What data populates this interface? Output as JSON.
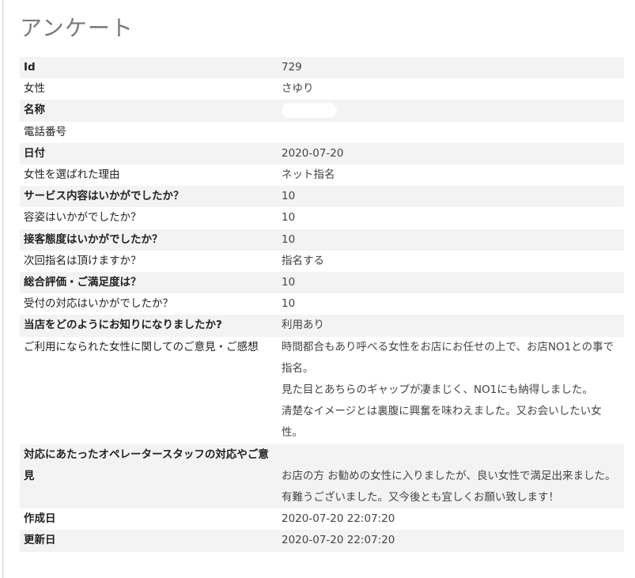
{
  "page": {
    "title": "アンケート"
  },
  "rows": [
    {
      "label": "Id",
      "value": "729"
    },
    {
      "label": "女性",
      "value": "さゆり"
    },
    {
      "label": "名称",
      "value": ""
    },
    {
      "label": "電話番号",
      "value": ""
    },
    {
      "label": "日付",
      "value": "2020-07-20"
    },
    {
      "label": "女性を選ばれた理由",
      "value": "ネット指名"
    },
    {
      "label": "サービス内容はいかがでしたか？",
      "value": "10"
    },
    {
      "label": "容姿はいかがでしたか？",
      "value": "10"
    },
    {
      "label": "接客態度はいかがでしたか？",
      "value": "10"
    },
    {
      "label": "次回指名は頂けますか？",
      "value": "指名する"
    },
    {
      "label": "総合評価・ご満足度は？",
      "value": "10"
    },
    {
      "label": "受付の対応はいかがでしたか？",
      "value": "10"
    },
    {
      "label": "当店をどのようにお知りになりましたか?",
      "value": "利用あり"
    },
    {
      "label": "ご利用になられた女性に関してのご意見・ご感想",
      "value": [
        "時間都合もあり呼べる女性をお店にお任せの上で、お店NO1との事で指名。",
        "見た目とあちらのギャップが凄まじく、NO1にも納得しました。",
        "清楚なイメージとは裏腹に興奮を味わえました。又お会いしたい女性。"
      ]
    },
    {
      "label": "対応にあたったオペレータースタッフの対応やご意見",
      "value": [
        "",
        "お店の方 お勧めの女性に入りましたが、良い女性で満足出来ました。",
        "有難うございました。又今後とも宜しくお願い致します！"
      ]
    },
    {
      "label": "作成日",
      "value": "2020-07-20 22:07:20"
    },
    {
      "label": "更新日",
      "value": "2020-07-20 22:07:20"
    }
  ]
}
